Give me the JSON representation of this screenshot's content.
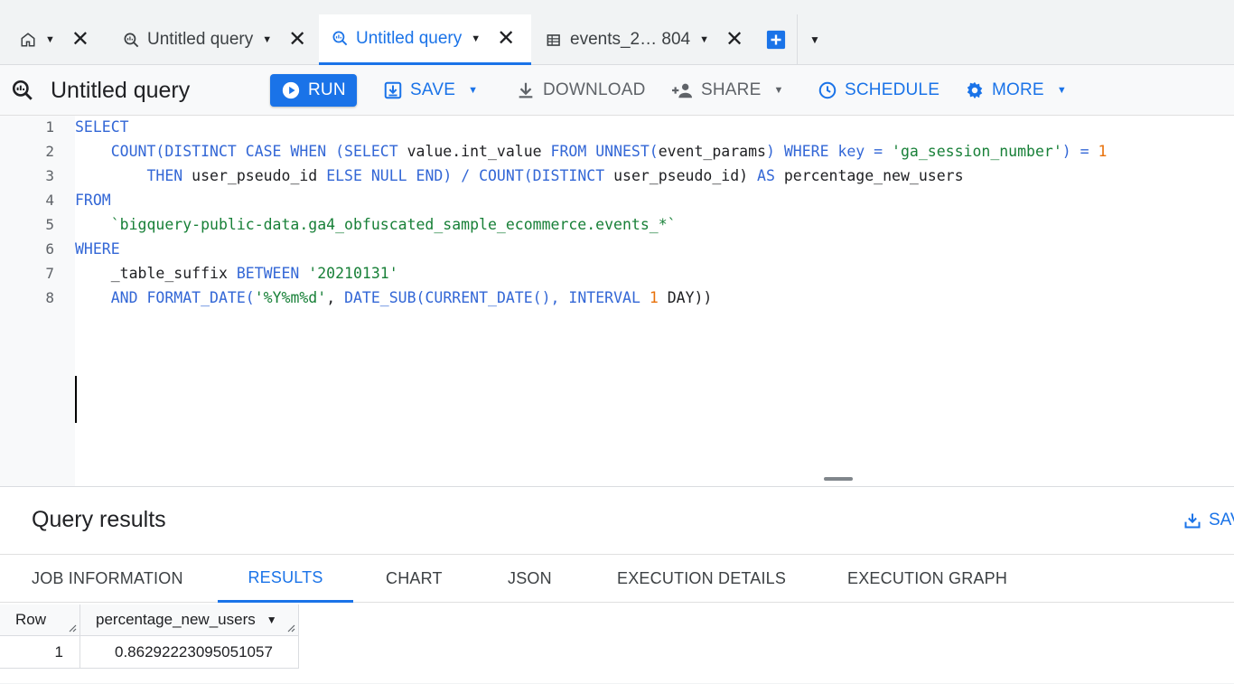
{
  "tabs": [
    {
      "label": "",
      "icon": "home-icon"
    },
    {
      "label": "Untitled query",
      "icon": "query-icon"
    },
    {
      "label": "Untitled query",
      "icon": "query-icon",
      "active": true
    },
    {
      "label": "events_2… 804",
      "icon": "table-icon"
    }
  ],
  "toolbar": {
    "title": "Untitled query",
    "run": "RUN",
    "save": "SAVE",
    "download": "DOWNLOAD",
    "share": "SHARE",
    "schedule": "SCHEDULE",
    "more": "MORE"
  },
  "editor": {
    "line_numbers": [
      "1",
      "2",
      "3",
      "4",
      "5",
      "6",
      "7",
      "8"
    ],
    "lines": [
      [
        {
          "t": "SELECT",
          "c": "kw"
        }
      ],
      [
        {
          "t": "    "
        },
        {
          "t": "COUNT(DISTINCT CASE WHEN (SELECT",
          "c": "kw"
        },
        {
          "t": " value.int_value "
        },
        {
          "t": "FROM UNNEST(",
          "c": "kw"
        },
        {
          "t": "event_params"
        },
        {
          "t": ") WHERE key =",
          "c": "kw"
        },
        {
          "t": " "
        },
        {
          "t": "'ga_session_number'",
          "c": "st"
        },
        {
          "t": ") = ",
          "c": "kw"
        },
        {
          "t": "1",
          "c": "nm"
        }
      ],
      [
        {
          "t": "        "
        },
        {
          "t": "THEN",
          "c": "kw"
        },
        {
          "t": " user_pseudo_id "
        },
        {
          "t": "ELSE NULL END) / COUNT(DISTINCT",
          "c": "kw"
        },
        {
          "t": " user_pseudo_id) "
        },
        {
          "t": "AS",
          "c": "kw"
        },
        {
          "t": " percentage_new_users"
        }
      ],
      [
        {
          "t": "FROM",
          "c": "kw"
        }
      ],
      [
        {
          "t": "    "
        },
        {
          "t": "`bigquery-public-data.ga4_obfuscated_sample_ecommerce.events_*`",
          "c": "st"
        }
      ],
      [
        {
          "t": "WHERE",
          "c": "kw"
        }
      ],
      [
        {
          "t": "    _table_suffix "
        },
        {
          "t": "BETWEEN",
          "c": "kw"
        },
        {
          "t": " "
        },
        {
          "t": "'20210131'",
          "c": "st"
        }
      ],
      [
        {
          "t": "    "
        },
        {
          "t": "AND FORMAT_DATE(",
          "c": "kw"
        },
        {
          "t": "'%Y%m%d'",
          "c": "st"
        },
        {
          "t": ", "
        },
        {
          "t": "DATE_SUB(CURRENT_DATE(), INTERVAL",
          "c": "kw"
        },
        {
          "t": " "
        },
        {
          "t": "1",
          "c": "nm"
        },
        {
          "t": " DAY))"
        }
      ]
    ]
  },
  "results": {
    "title": "Query results",
    "save_label": "SAV",
    "tabs": [
      "JOB INFORMATION",
      "RESULTS",
      "CHART",
      "JSON",
      "EXECUTION DETAILS",
      "EXECUTION GRAPH"
    ],
    "active_tab": "RESULTS",
    "columns": [
      "Row",
      "percentage_new_users"
    ],
    "rows": [
      [
        "1",
        "0.86292223095051057"
      ]
    ]
  },
  "colors": {
    "accent": "#1a73e8",
    "keyword": "#3367d6",
    "string": "#188038",
    "number": "#e8710a"
  }
}
